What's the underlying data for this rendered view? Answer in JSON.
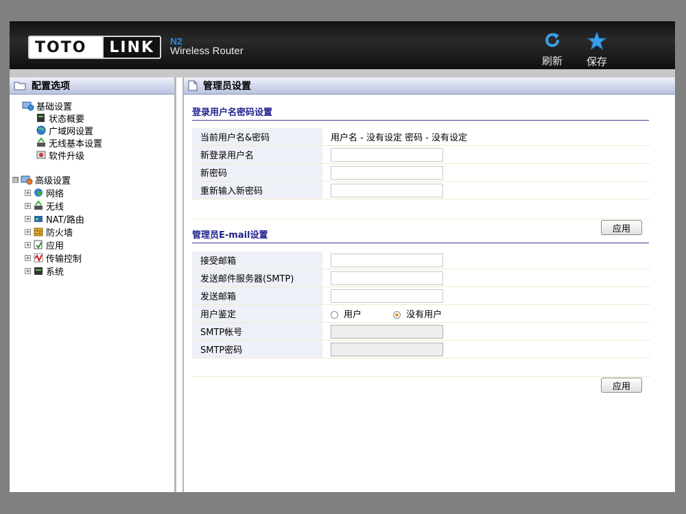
{
  "header": {
    "logo_left": "TOTO",
    "logo_right": "LINK",
    "model": "N2",
    "product": "Wireless Router",
    "refresh_label": "刷新",
    "save_label": "保存"
  },
  "sidebar": {
    "title": "配置选项",
    "basic": {
      "label": "基础设置",
      "items": [
        "状态概要",
        "广域网设置",
        "无线基本设置",
        "软件升级"
      ]
    },
    "advanced": {
      "label": "高级设置",
      "toggle": "⊟",
      "items": [
        "网络",
        "无线",
        "NAT/路由",
        "防火墙",
        "应用",
        "传输控制",
        "系统"
      ]
    }
  },
  "main": {
    "title": "管理员设置",
    "login": {
      "title": "登录用户名密码设置",
      "current_label": "当前用户名&密码",
      "current_value": "用户名 - 没有设定 密码 - 没有设定",
      "new_user_label": "新登录用户名",
      "new_pass_label": "新密码",
      "confirm_pass_label": "重新输入新密码",
      "apply": "应用"
    },
    "email": {
      "title": "管理员E-mail设置",
      "recv_label": "接受邮箱",
      "smtp_server_label": "发送邮件服务器(SMTP)",
      "sender_label": "发送邮箱",
      "auth_label": "用户鉴定",
      "auth_options": [
        "用户",
        "没有用户"
      ],
      "auth_selected": "没有用户",
      "smtp_account_label": "SMTP帐号",
      "smtp_pass_label": "SMTP密码",
      "apply": "应用"
    }
  },
  "colors": {
    "section_title": "#202090",
    "accent_blue": "#2b8ad6",
    "radio_selected": "#e0a020"
  }
}
